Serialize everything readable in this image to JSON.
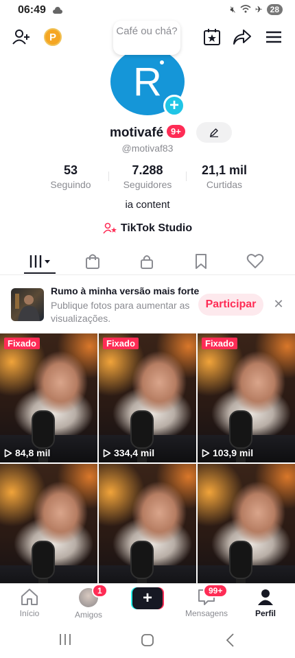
{
  "status": {
    "time": "06:49",
    "battery": "28"
  },
  "profile": {
    "bubble_text": "Café ou chá?",
    "avatar_letter": "R",
    "display_name": "motivafé",
    "name_badge": "9+",
    "username": "@motivaf83",
    "bio": "ia content",
    "studio_label": "TikTok Studio"
  },
  "stats": [
    {
      "value": "53",
      "label": "Seguindo"
    },
    {
      "value": "7.288",
      "label": "Seguidores"
    },
    {
      "value": "21,1 mil",
      "label": "Curtidas"
    }
  ],
  "tabs": [
    "videos-icon",
    "shop-icon",
    "lock-icon",
    "bookmark-icon",
    "heart-icon"
  ],
  "promo": {
    "title": "Rumo à minha versão mais forte",
    "subtitle": "Publique fotos para aumentar as visualizações.",
    "button": "Participar"
  },
  "videos": [
    {
      "pinned": "Fixado",
      "views": "84,8 mil"
    },
    {
      "pinned": "Fixado",
      "views": "334,4 mil"
    },
    {
      "pinned": "Fixado",
      "views": "103,9 mil"
    },
    {
      "pinned": "",
      "views": ""
    },
    {
      "pinned": "",
      "views": ""
    },
    {
      "pinned": "",
      "views": ""
    }
  ],
  "nav": {
    "home": "Início",
    "friends": "Amigos",
    "friends_badge": "1",
    "messages": "Mensagens",
    "messages_badge": "99+",
    "profile": "Perfil"
  },
  "colors": {
    "accent": "#fe2c55",
    "avatar_bg": "#1596d8",
    "cyan": "#25f4ee"
  }
}
